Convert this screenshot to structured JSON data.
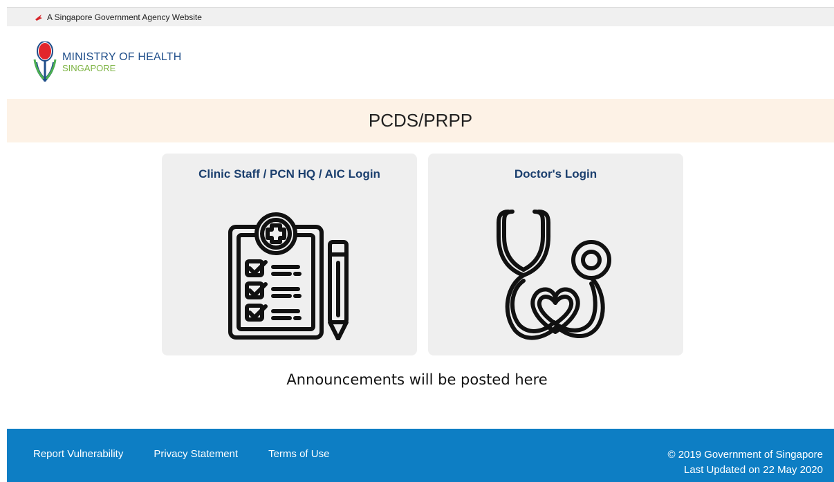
{
  "masthead": {
    "text": "A Singapore Government Agency Website"
  },
  "logo": {
    "line1": "MINISTRY OF HEALTH",
    "line2": "SINGAPORE"
  },
  "banner": {
    "title": "PCDS/PRPP"
  },
  "cards": [
    {
      "title": "Clinic Staff / PCN HQ / AIC Login",
      "icon": "clipboard-checklist-icon"
    },
    {
      "title": "Doctor's Login",
      "icon": "stethoscope-heart-icon"
    }
  ],
  "announcement": "Announcements will be posted here",
  "footer": {
    "links": [
      "Report Vulnerability",
      "Privacy Statement",
      "Terms of Use"
    ],
    "copyright": "© 2019 Government of Singapore",
    "updated": "Last Updated on 22 May 2020"
  },
  "colors": {
    "banner_bg": "#fdf2e6",
    "card_bg": "#efefef",
    "footer_bg": "#0d7ec4",
    "title_blue": "#1b3f6e"
  }
}
